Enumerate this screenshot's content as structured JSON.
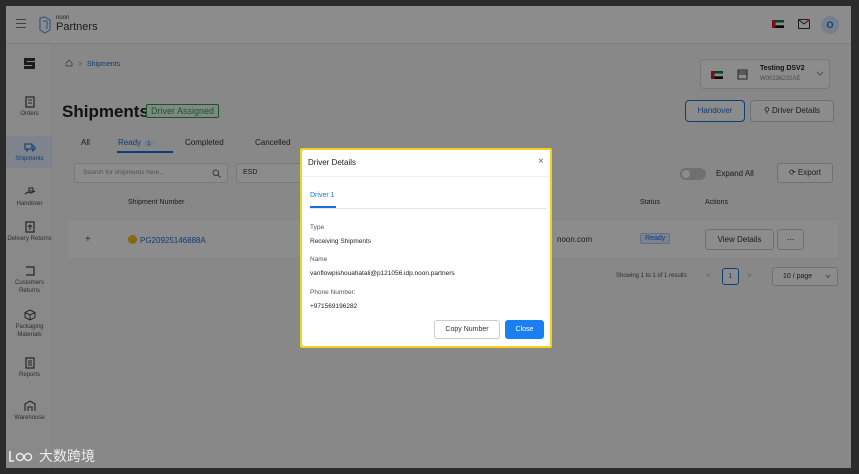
{
  "topbar": {
    "brand_small": "noon",
    "brand_big": "Partners",
    "avatar": "O"
  },
  "sidebar": {
    "items": [
      {
        "label": "Orders",
        "icon": "orders-icon"
      },
      {
        "label": "Shipments",
        "icon": "truck-icon",
        "active": true
      },
      {
        "label": "Handover",
        "icon": "handover-icon"
      },
      {
        "label": "Delivery Returns",
        "icon": "delivery-returns-icon"
      },
      {
        "label": "Customers Returns",
        "icon": "customer-returns-icon"
      },
      {
        "label": "Packaging Materials",
        "icon": "package-icon"
      },
      {
        "label": "Reports",
        "icon": "reports-icon"
      },
      {
        "label": "Warehouse",
        "icon": "warehouse-icon"
      }
    ]
  },
  "breadcrumb": {
    "current": "Shipments",
    "sep": ">"
  },
  "page": {
    "title": "Shipments",
    "status_badge": "Driver Assigned"
  },
  "store": {
    "name": "Testing DSV2",
    "id": "W00136232AE"
  },
  "actions": {
    "handover": "Handover",
    "driver_details": "Driver Details"
  },
  "tabs": {
    "all": "All",
    "ready": "Ready",
    "ready_count": "1",
    "completed": "Completed",
    "cancelled": "Cancelled"
  },
  "filters": {
    "search_placeholder": "Search for shipments here...",
    "esd": "ESD",
    "expand_all": "Expand All",
    "export": "Export"
  },
  "table": {
    "headers": {
      "shipment_number": "Shipment Number",
      "status": "Status",
      "actions": "Actions"
    },
    "rows": [
      {
        "expand": "+",
        "shipment_number": "PG20925146888A",
        "email_fragment": "noon.com",
        "status": "Ready",
        "view": "View Details",
        "more": "..."
      }
    ]
  },
  "pagination": {
    "summary": "Showing 1 to 1 of 1 results",
    "prev": "<",
    "page": "1",
    "next": ">",
    "page_size": "10 / page"
  },
  "modal": {
    "title": "Driver Details",
    "close_glyph": "×",
    "tab": "Driver 1",
    "type_label": "Type",
    "type_value": "Receiving Shipments",
    "name_label": "Name",
    "name_value": "vanflowpishouahatali@p121056.idp.noon.partners",
    "phone_label": "Phone Number:",
    "phone_value": "+971569196282",
    "copy_button": "Copy Number",
    "close_button": "Close"
  },
  "watermark": {
    "text": "大数跨境"
  },
  "colors": {
    "primary": "#1a6fd9",
    "success": "#2e9b4b",
    "highlight": "#f2d21a"
  }
}
